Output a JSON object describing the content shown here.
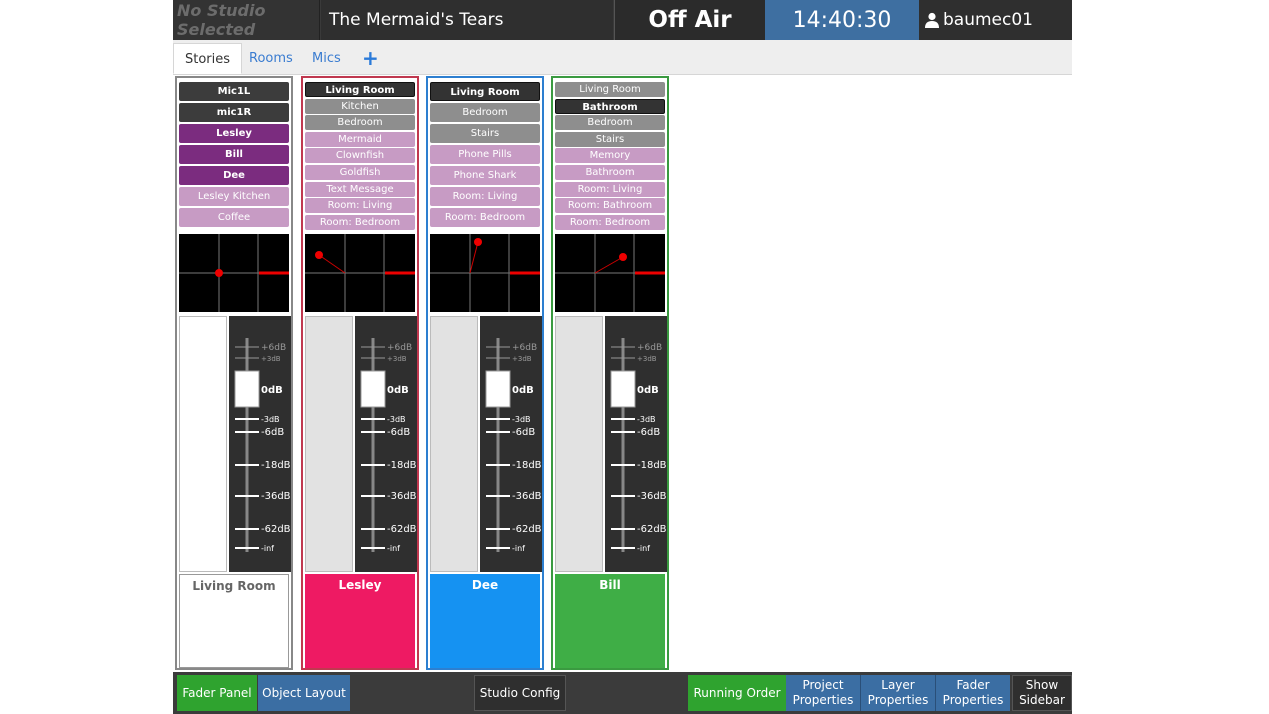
{
  "header": {
    "studio": "No Studio Selected",
    "project": "The Mermaid's Tears",
    "status": "Off Air",
    "clock": "14:40:30",
    "user": "baumec01"
  },
  "tabs": [
    {
      "label": "Stories"
    },
    {
      "label": "Rooms"
    },
    {
      "label": "Mics"
    },
    {
      "label": "+"
    }
  ],
  "strips": [
    {
      "buttons": [
        {
          "label": "Mic1L",
          "style": "dark"
        },
        {
          "label": "mic1R",
          "style": "dark"
        },
        {
          "label": "Lesley",
          "style": "purple"
        },
        {
          "label": "Bill",
          "style": "purple"
        },
        {
          "label": "Dee",
          "style": "purple"
        },
        {
          "label": "Lesley Kitchen",
          "style": "lpurple"
        },
        {
          "label": "Coffee",
          "style": "lpurple"
        }
      ],
      "label": "Living Room",
      "label_color": "#ffffff",
      "label_text_color": "#666666",
      "border_color": "#888888"
    },
    {
      "buttons": [
        {
          "label": "Living Room",
          "style": "sel"
        },
        {
          "label": "Kitchen",
          "style": "grey"
        },
        {
          "label": "Bedroom",
          "style": "grey"
        },
        {
          "label": "Mermaid",
          "style": "lpurple"
        },
        {
          "label": "Clownfish",
          "style": "lpurple"
        },
        {
          "label": "Goldfish",
          "style": "lpurple"
        },
        {
          "label": "Text Message",
          "style": "lpurple"
        },
        {
          "label": "Room: Living",
          "style": "lpurple"
        },
        {
          "label": "Room: Bedroom",
          "style": "lpurple"
        }
      ],
      "label": "Lesley",
      "label_color": "#ee1a63",
      "label_text_color": "#ffffff",
      "border_color": "#c0384f"
    },
    {
      "buttons": [
        {
          "label": "Living Room",
          "style": "sel"
        },
        {
          "label": "Bedroom",
          "style": "grey"
        },
        {
          "label": "Stairs",
          "style": "grey"
        },
        {
          "label": "Phone Pills",
          "style": "lpurple"
        },
        {
          "label": "Phone Shark",
          "style": "lpurple"
        },
        {
          "label": "Room: Living",
          "style": "lpurple"
        },
        {
          "label": "Room: Bedroom",
          "style": "lpurple"
        }
      ],
      "label": "Dee",
      "label_color": "#1592f2",
      "label_text_color": "#ffffff",
      "border_color": "#2d7fd0"
    },
    {
      "buttons": [
        {
          "label": "Living Room",
          "style": "grey"
        },
        {
          "label": "Bathroom",
          "style": "sel"
        },
        {
          "label": "Bedroom",
          "style": "grey"
        },
        {
          "label": "Stairs",
          "style": "grey"
        },
        {
          "label": "Memory",
          "style": "lpurple"
        },
        {
          "label": "Bathroom",
          "style": "lpurple"
        },
        {
          "label": "Room: Living",
          "style": "lpurple"
        },
        {
          "label": "Room: Bathroom",
          "style": "lpurple"
        },
        {
          "label": "Room: Bedroom",
          "style": "lpurple"
        }
      ],
      "label": "Bill",
      "label_color": "#3fae46",
      "label_text_color": "#ffffff",
      "border_color": "#3a9a40"
    }
  ],
  "fader_scale": [
    "+6dB",
    "+3dB",
    "0dB",
    "-3dB",
    "-6dB",
    "-18dB",
    "-36dB",
    "-62dB",
    "-inf"
  ],
  "bottom": {
    "fader_panel": "Fader Panel",
    "object_layout": "Object Layout",
    "studio_config": "Studio Config",
    "running_order": "Running Order",
    "project_properties_1": "Project",
    "project_properties_2": "Properties",
    "layer_properties_1": "Layer",
    "layer_properties_2": "Properties",
    "fader_properties_1": "Fader",
    "fader_properties_2": "Properties",
    "show_sidebar_1": "Show",
    "show_sidebar_2": "Sidebar"
  }
}
